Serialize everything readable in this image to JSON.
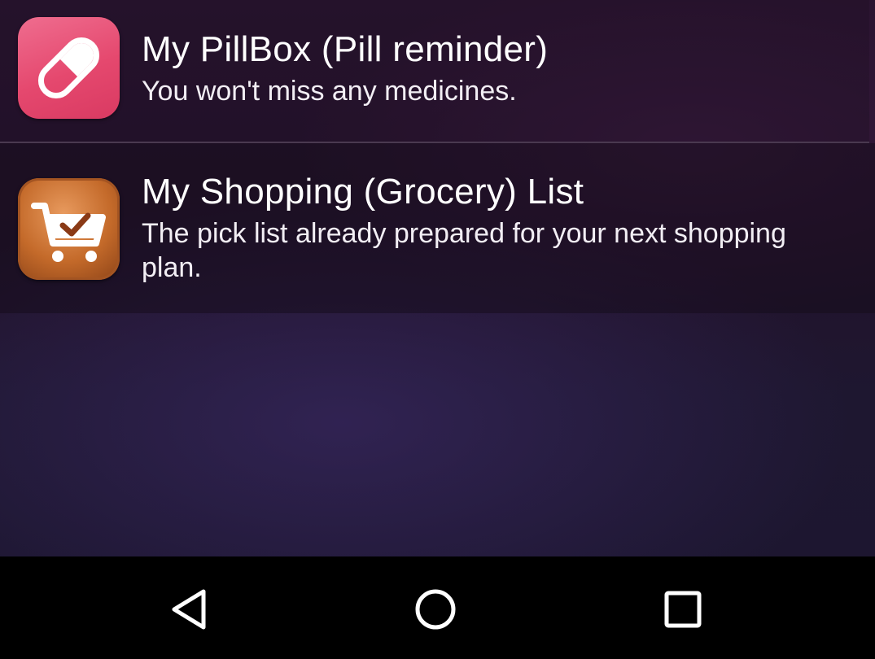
{
  "apps": [
    {
      "title": "My PillBox (Pill reminder)",
      "subtitle": "You won't miss any medicines.",
      "icon": "pill-icon",
      "icon_color": "#E5486E"
    },
    {
      "title": "My Shopping (Grocery) List",
      "subtitle": "The pick list already prepared for your next shopping plan.",
      "icon": "shopping-cart-check-icon",
      "icon_color": "#C46A2A"
    }
  ],
  "navbar": {
    "back_icon": "back-triangle-icon",
    "home_icon": "home-circle-icon",
    "recents_icon": "recents-square-icon"
  }
}
